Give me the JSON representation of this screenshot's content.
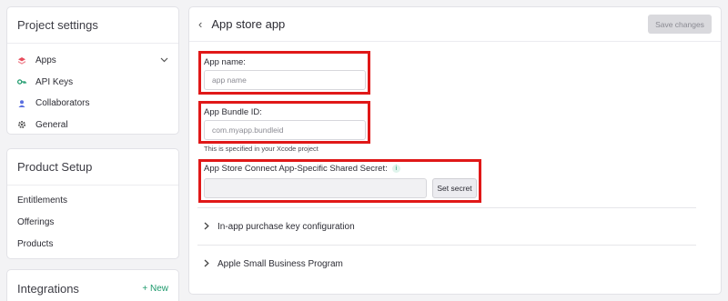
{
  "sidebar": {
    "project_settings": {
      "title": "Project settings",
      "items": [
        {
          "label": "Apps",
          "icon": "apps-icon",
          "color": "#e84c5c"
        },
        {
          "label": "API Keys",
          "icon": "key-icon",
          "color": "#1d9a6c"
        },
        {
          "label": "Collaborators",
          "icon": "person-icon",
          "color": "#5a6fe0"
        },
        {
          "label": "General",
          "icon": "gear-icon",
          "color": "#555555"
        }
      ]
    },
    "product_setup": {
      "title": "Product Setup",
      "items": [
        "Entitlements",
        "Offerings",
        "Products"
      ]
    },
    "integrations": {
      "title": "Integrations",
      "new_label": "+ New"
    }
  },
  "main": {
    "back_glyph": "‹",
    "title": "App store app",
    "save_label": "Save changes",
    "app_name": {
      "label": "App name:",
      "placeholder": "app name"
    },
    "bundle_id": {
      "label": "App Bundle ID:",
      "placeholder": "com.myapp.bundleid",
      "hint": "This is specified in your Xcode project"
    },
    "shared_secret": {
      "label": "App Store Connect App-Specific Shared Secret:",
      "info": "i",
      "button": "Set secret"
    },
    "sections": [
      "In-app purchase key configuration",
      "Apple Small Business Program"
    ]
  },
  "colors": {
    "accent": "#1d9a6c",
    "highlight": "#e01818"
  }
}
